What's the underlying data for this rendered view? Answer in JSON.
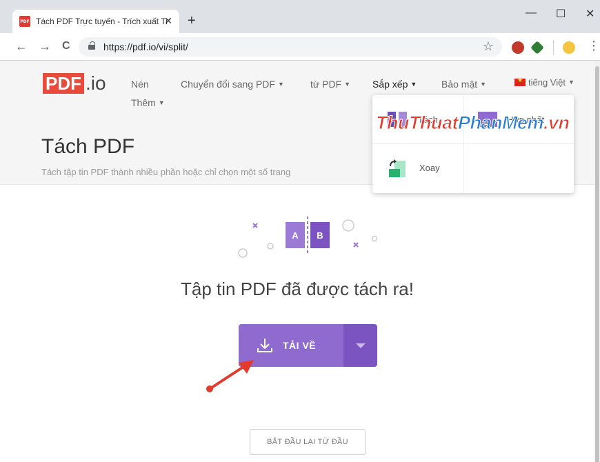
{
  "browser": {
    "tab_title": "Tách PDF Trực tuyến - Trích xuất Trang",
    "tab_favicon": "PDF",
    "tab_close": "✕",
    "new_tab": "+",
    "minimize": "—",
    "maximize": "☐",
    "close": "✕",
    "url": "https://pdf.io/vi/split/",
    "back": "←",
    "forward": "→",
    "reload": "C",
    "star": "☆",
    "menu": "⋮"
  },
  "site": {
    "logo_pdf": "PDF",
    "logo_io": ".io",
    "nav": [
      {
        "label": "Nén"
      },
      {
        "label": "Chuyển đổi sang PDF"
      },
      {
        "label": "từ PDF"
      },
      {
        "label": "Sắp xếp"
      },
      {
        "label": "Bảo mật"
      },
      {
        "label": "tiếng Việt"
      },
      {
        "label": "Thêm"
      }
    ],
    "title": "Tách PDF",
    "subtitle": "Tách tập tin PDF thành nhiều phần hoặc chỉ chọn một số trang"
  },
  "dropdown": {
    "items": [
      {
        "label": "Tách"
      },
      {
        "label": "Hợp nhất"
      },
      {
        "label": "Xoay"
      }
    ]
  },
  "watermark": {
    "part1": "Thu",
    "part2": "Thuat",
    "part3": "PhanMem",
    "part4": ".vn"
  },
  "main": {
    "illus_a": "A",
    "illus_b": "B",
    "success": "Tập tin PDF đã được tách ra!",
    "download_label": "TẢI VỀ",
    "restart_label": "BẮT ĐẦU LẠI TỪ ĐẦU"
  },
  "colors": {
    "accent": "#8f6bd0",
    "accent_dark": "#7b54c1",
    "logo_red": "#e84a3b",
    "arrow_red": "#e23b2e"
  }
}
